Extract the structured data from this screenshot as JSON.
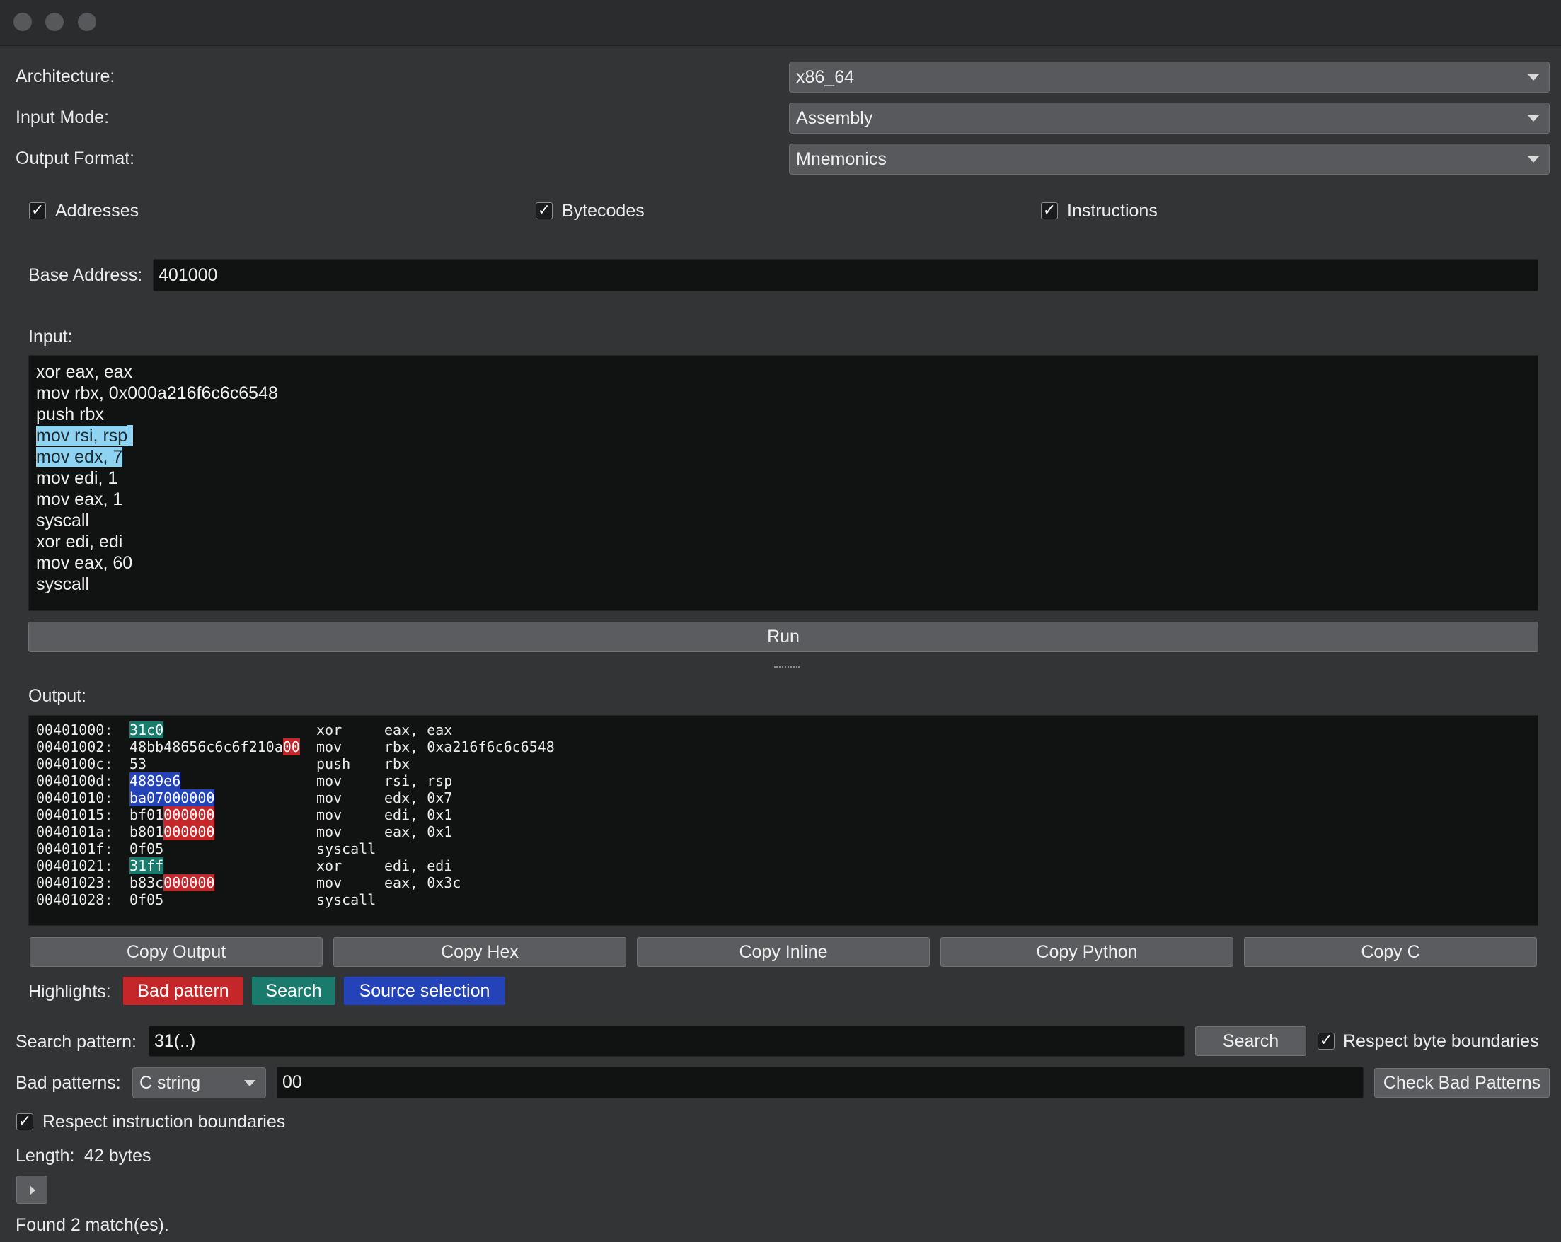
{
  "window": {
    "buttons": [
      "close",
      "minimize",
      "zoom"
    ]
  },
  "settings": {
    "architecture_label": "Architecture:",
    "architecture_value": "x86_64",
    "input_mode_label": "Input Mode:",
    "input_mode_value": "Assembly",
    "output_format_label": "Output Format:",
    "output_format_value": "Mnemonics"
  },
  "options": {
    "addresses": {
      "label": "Addresses",
      "checked": true
    },
    "bytecodes": {
      "label": "Bytecodes",
      "checked": true
    },
    "instructions": {
      "label": "Instructions",
      "checked": true
    }
  },
  "base_address": {
    "label": "Base Address:",
    "value": "401000"
  },
  "input": {
    "label": "Input:",
    "lines": [
      "xor eax, eax",
      "mov rbx, 0x000a216f6c6c6548",
      "push rbx",
      "mov rsi, rsp",
      "mov edx, 7",
      "mov edi, 1",
      "mov eax, 1",
      "syscall",
      "xor edi, edi",
      "mov eax, 60",
      "syscall"
    ],
    "selected_lines": [
      3,
      4
    ]
  },
  "run_button": "Run",
  "output": {
    "label": "Output:",
    "rows": [
      {
        "addr": "00401000:",
        "bytes": "31c0",
        "mnemonic": "xor",
        "operands": "eax, eax",
        "highlights": [
          {
            "start": 0,
            "end": 4,
            "kind": "search"
          }
        ]
      },
      {
        "addr": "00401002:",
        "bytes": "48bb48656c6c6f210a00",
        "mnemonic": "mov",
        "operands": "rbx, 0xa216f6c6c6548",
        "highlights": [
          {
            "start": 18,
            "end": 20,
            "kind": "bad"
          }
        ]
      },
      {
        "addr": "0040100c:",
        "bytes": "53",
        "mnemonic": "push",
        "operands": "rbx",
        "highlights": []
      },
      {
        "addr": "0040100d:",
        "bytes": "4889e6",
        "mnemonic": "mov",
        "operands": "rsi, rsp",
        "highlights": [
          {
            "start": 0,
            "end": 6,
            "kind": "source"
          }
        ]
      },
      {
        "addr": "00401010:",
        "bytes": "ba07000000",
        "mnemonic": "mov",
        "operands": "edx, 0x7",
        "highlights": [
          {
            "start": 0,
            "end": 10,
            "kind": "source"
          }
        ]
      },
      {
        "addr": "00401015:",
        "bytes": "bf01000000",
        "mnemonic": "mov",
        "operands": "edi, 0x1",
        "highlights": [
          {
            "start": 4,
            "end": 10,
            "kind": "bad"
          }
        ]
      },
      {
        "addr": "0040101a:",
        "bytes": "b801000000",
        "mnemonic": "mov",
        "operands": "eax, 0x1",
        "highlights": [
          {
            "start": 4,
            "end": 10,
            "kind": "bad"
          }
        ]
      },
      {
        "addr": "0040101f:",
        "bytes": "0f05",
        "mnemonic": "syscall",
        "operands": "",
        "highlights": []
      },
      {
        "addr": "00401021:",
        "bytes": "31ff",
        "mnemonic": "xor",
        "operands": "edi, edi",
        "highlights": [
          {
            "start": 0,
            "end": 4,
            "kind": "search"
          }
        ]
      },
      {
        "addr": "00401023:",
        "bytes": "b83c000000",
        "mnemonic": "mov",
        "operands": "eax, 0x3c",
        "highlights": [
          {
            "start": 4,
            "end": 10,
            "kind": "bad"
          }
        ]
      },
      {
        "addr": "00401028:",
        "bytes": "0f05",
        "mnemonic": "syscall",
        "operands": "",
        "highlights": []
      }
    ]
  },
  "copy_buttons": [
    "Copy Output",
    "Copy Hex",
    "Copy Inline",
    "Copy Python",
    "Copy C"
  ],
  "highlights": {
    "label": "Highlights:",
    "bad": {
      "label": "Bad pattern",
      "color": "#c4262a"
    },
    "search": {
      "label": "Search",
      "color": "#1a7a6c"
    },
    "source": {
      "label": "Source selection",
      "color": "#2443b8"
    }
  },
  "search": {
    "label": "Search pattern:",
    "value": "31(..)",
    "button": "Search",
    "respect_byte_boundaries": {
      "label": "Respect byte boundaries",
      "checked": true
    }
  },
  "bad_patterns": {
    "label": "Bad patterns:",
    "type_value": "C string",
    "value": "00",
    "button": "Check Bad Patterns"
  },
  "respect_instruction_boundaries": {
    "label": "Respect instruction boundaries",
    "checked": true
  },
  "length": {
    "label": "Length:",
    "value": "42 bytes"
  },
  "status": "Found 2 match(es)."
}
